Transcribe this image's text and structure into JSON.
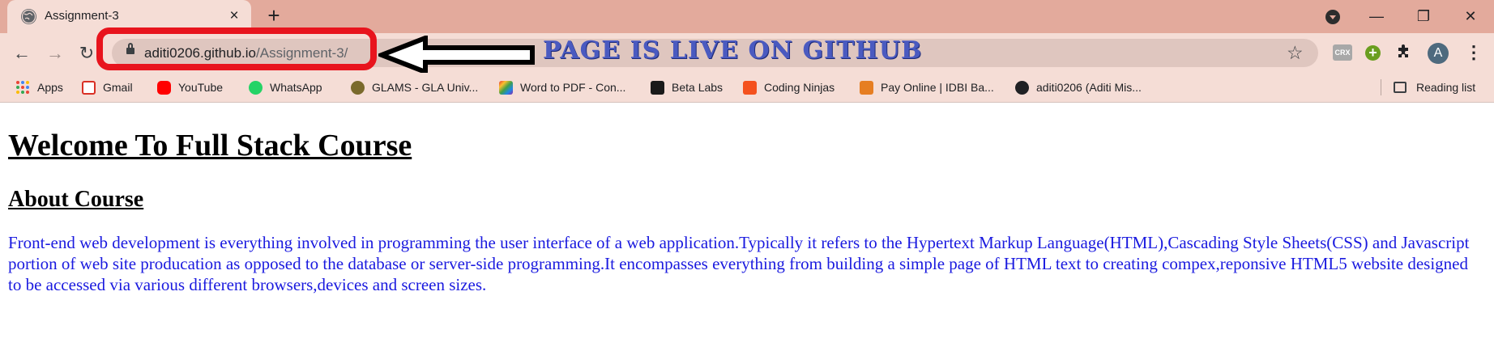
{
  "tab": {
    "title": "Assignment-3",
    "close": "×"
  },
  "new_tab": "+",
  "window": {
    "minimize": "—",
    "restore": "❐",
    "close": "✕"
  },
  "toolbar": {
    "back": "←",
    "forward": "→",
    "reload": "↻"
  },
  "address": {
    "host": "aditi0206.github.io",
    "path": "/Assignment-3/"
  },
  "annotation": {
    "text": "PAGE IS LIVE ON GITHUB",
    "box_color": "#e8141d",
    "text_color": "#4a5ac0"
  },
  "extensions": {
    "crx": "CRX",
    "green": "+",
    "puzzle": "✱",
    "avatar": "A",
    "menu": "⋮",
    "star": "☆"
  },
  "bookmarks": [
    {
      "label": "Apps",
      "icon": "apps-grid-icon"
    },
    {
      "label": "Gmail",
      "icon": "gmail-icon",
      "color": "#d93025"
    },
    {
      "label": "YouTube",
      "icon": "youtube-icon",
      "color": "#ff0000"
    },
    {
      "label": "WhatsApp",
      "icon": "whatsapp-icon",
      "color": "#25d366"
    },
    {
      "label": "GLAMS - GLA Univ...",
      "icon": "gla-icon",
      "color": "#7a6a2c"
    },
    {
      "label": "Word to PDF - Con...",
      "icon": "word-to-pdf-icon",
      "color": "#e64a19"
    },
    {
      "label": "Beta Labs",
      "icon": "beta-labs-icon",
      "color": "#1a1a1a"
    },
    {
      "label": "Coding Ninjas",
      "icon": "coding-ninjas-icon",
      "color": "#f4511e"
    },
    {
      "label": "Pay Online | IDBI Ba...",
      "icon": "idbi-icon",
      "color": "#e67e22"
    },
    {
      "label": "aditi0206 (Aditi Mis...",
      "icon": "github-icon",
      "color": "#202124"
    }
  ],
  "reading_list": "Reading list",
  "page": {
    "heading": "Welcome To Full Stack Course",
    "subheading": "About Course",
    "paragraph_color": "#1a1adf",
    "paragraph": "Front-end web development is everything involved in programming the user interface of a web application.Typically it refers to the Hypertext Markup Language(HTML),Cascading Style Sheets(CSS) and Javascript portion of web site producation as opposed to the database or server-side programming.It encompasses everything from building a simple page of HTML text to creating compex,reponsive HTML5 website designed to be accessed via various different browsers,devices and screen sizes."
  }
}
